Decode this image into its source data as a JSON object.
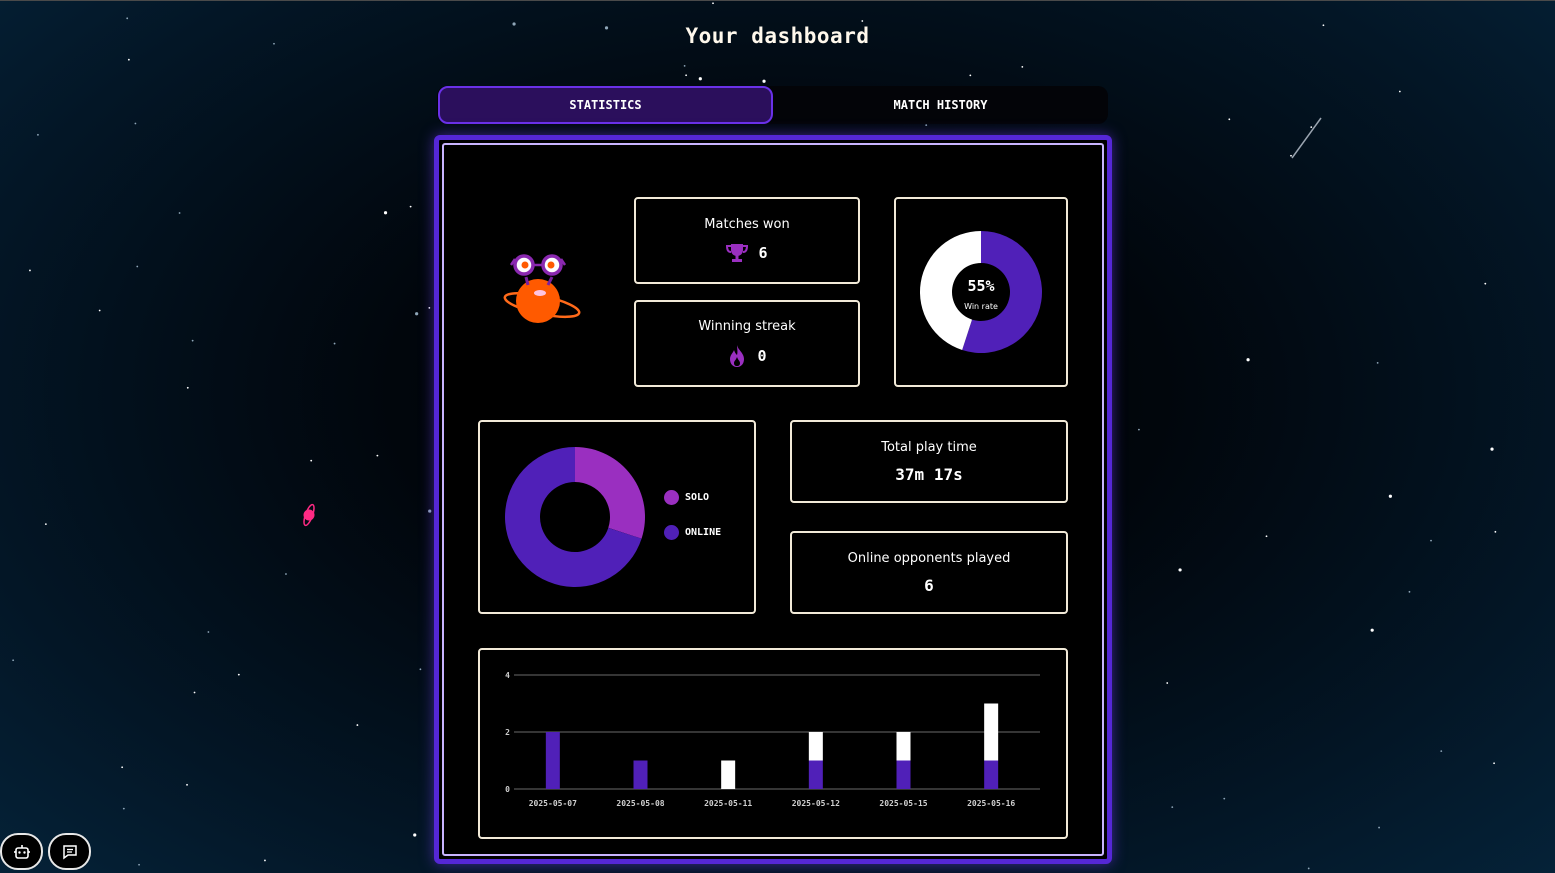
{
  "page": {
    "title": "Your dashboard"
  },
  "tabs": [
    {
      "label": "STATISTICS",
      "active": true
    },
    {
      "label": "MATCH HISTORY",
      "active": false
    }
  ],
  "stats": {
    "matches_won": {
      "label": "Matches won",
      "value": "6",
      "icon": "trophy-icon"
    },
    "winning_streak": {
      "label": "Winning streak",
      "value": "0",
      "icon": "flame-icon"
    },
    "win_rate": {
      "percent_text": "55%",
      "label": "Win rate",
      "value": 0.55
    },
    "total_play_time": {
      "label": "Total play time",
      "value": "37m 17s"
    },
    "online_opponents": {
      "label": "Online opponents played",
      "value": "6"
    }
  },
  "mode_chart": {
    "legend": [
      {
        "name": "SOLO",
        "color": "#9a2fc0"
      },
      {
        "name": "ONLINE",
        "color": "#5020b8"
      }
    ]
  },
  "chart_data": [
    {
      "type": "pie",
      "categories": [
        "Win rate",
        ""
      ],
      "values": [
        55,
        45
      ],
      "colors": [
        "#5020b8",
        "#ffffff"
      ],
      "center_text": "55%",
      "center_label": "Win rate"
    },
    {
      "type": "pie",
      "categories": [
        "SOLO",
        "ONLINE"
      ],
      "values": [
        3,
        7
      ],
      "colors": [
        "#9a2fc0",
        "#5020b8"
      ],
      "legend": "right"
    },
    {
      "type": "bar",
      "stacked": true,
      "categories": [
        "2025-05-07",
        "2025-05-08",
        "2025-05-11",
        "2025-05-12",
        "2025-05-15",
        "2025-05-16"
      ],
      "series": [
        {
          "values": [
            2,
            1,
            0,
            1,
            1,
            1
          ],
          "color": "#5020b8"
        },
        {
          "values": [
            0,
            0,
            1,
            1,
            1,
            2
          ],
          "color": "#ffffff"
        }
      ],
      "yticks": [
        "0",
        "2",
        "4"
      ],
      "ylim": [
        0,
        4
      ],
      "grid": true
    }
  ],
  "colors": {
    "accent": "#5527d6",
    "card_border": "#f2ead8",
    "solo": "#9a2fc0",
    "online": "#5020b8"
  },
  "bottom_buttons": [
    {
      "icon": "robot-icon"
    },
    {
      "icon": "chat-icon"
    }
  ]
}
